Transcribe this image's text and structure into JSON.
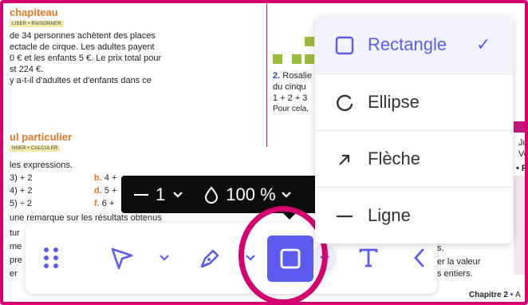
{
  "page": {
    "ex1": {
      "title": "chapiteau",
      "tag": "LISER • RAISONNER",
      "lines": [
        "de 34 personnes achètent des places",
        "ectacle de cirque. Les adultes payent",
        "0 € et les enfants 5 €. Le prix total pour",
        "st 224 €.",
        "y a-t-il d'adultes et d'enfants dans ce"
      ]
    },
    "ex2": {
      "title": "ul particulier",
      "tag": "NNER • CALCULER",
      "intro": "les expressions.",
      "col1": [
        "3) + 2",
        "4) + 2",
        "5) ÷ 2"
      ],
      "col2_labels": [
        "b.",
        "d.",
        "f."
      ],
      "col2_values": [
        "4 +",
        "5 +",
        "6 +"
      ],
      "bottom_lines": [
        "une remarque sur les résultats obtenus",
        "tur",
        "me",
        "pre",
        "er"
      ]
    },
    "middle": {
      "num": "2.",
      "lines": [
        "Rosalie",
        "du cinqu",
        "1 + 2 + 3",
        "Pour cela, "
      ]
    },
    "right_snippets": [
      "Ju",
      "Vo",
      "• Pe"
    ],
    "bottom_right_lines": [
      "s.",
      "er la valeur",
      "s entiers."
    ],
    "footer": {
      "chapter": "Chapitre 2",
      "sep": "•",
      "tail": "A"
    }
  },
  "tooltip": {
    "stroke_width": "1",
    "opacity": "100 %"
  },
  "toolbar": {
    "items": [
      "drag-handle",
      "select-tool",
      "pen-tool",
      "shape-tool",
      "text-tool",
      "collapse-toolbar"
    ]
  },
  "menu": {
    "items": [
      {
        "label": "Rectangle",
        "selected": true
      },
      {
        "label": "Ellipse",
        "selected": false
      },
      {
        "label": "Flèche",
        "selected": false
      },
      {
        "label": "Ligne",
        "selected": false
      }
    ],
    "check": "✓"
  },
  "colors": {
    "accent": "#5c5cf0",
    "highlight": "#d4006f",
    "tooltip_bg": "#0d0d0d",
    "section_title": "#e87722"
  }
}
